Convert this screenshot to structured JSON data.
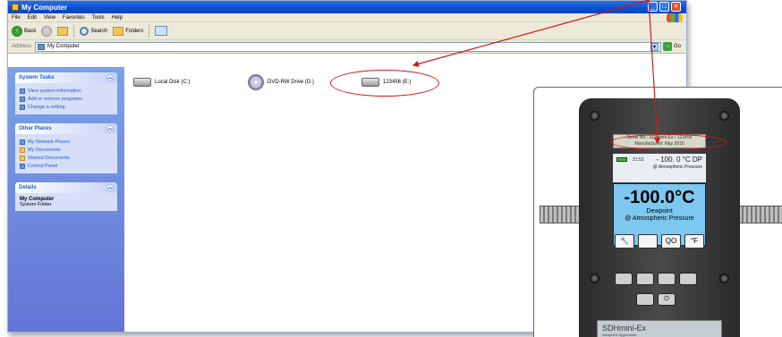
{
  "window": {
    "title": "My Computer",
    "buttons": [
      "_",
      "□",
      "✕"
    ]
  },
  "menu": [
    "File",
    "Edit",
    "View",
    "Favorites",
    "Tools",
    "Help"
  ],
  "toolbar": {
    "back": "Back",
    "search": "Search",
    "folders": "Folders"
  },
  "address": {
    "label": "Address",
    "value": "My Computer",
    "go": "Go"
  },
  "taskpane": {
    "system_tasks": {
      "title": "System Tasks",
      "items": [
        "View system information",
        "Add or remove programs",
        "Change a setting"
      ]
    },
    "other_places": {
      "title": "Other Places",
      "items": [
        "My Network Places",
        "My Documents",
        "Shared Documents",
        "Control Panel"
      ]
    },
    "details": {
      "title": "Details",
      "name": "My Computer",
      "sub": "System Folder"
    }
  },
  "drives": [
    {
      "label": "Local Disk (C:)"
    },
    {
      "label": "DVD-RW Drive (D:)"
    },
    {
      "label": "123456 (E:)"
    }
  ],
  "device": {
    "serial_label": "Serial No.: SDHmini-Ex / 123456",
    "manufactured": "Manufactured: May 2016",
    "time": "21:52",
    "top_reading": "- 100. 0 °C DP",
    "top_condition": "@ Atmospheric Pressure",
    "main_value": "-100.0°C",
    "main_label": "Dewpoint",
    "main_condition": "@ Atmospheric Pressure",
    "soft_keys": [
      "🔧",
      "",
      "QO",
      "°F"
    ],
    "power": "⏻",
    "model": "SDHmini-Ex",
    "model_sub": "Dewpoint Hygrometer"
  },
  "colors": {
    "highlight": "#cc1a1a",
    "screen": "#7cc8f0"
  }
}
